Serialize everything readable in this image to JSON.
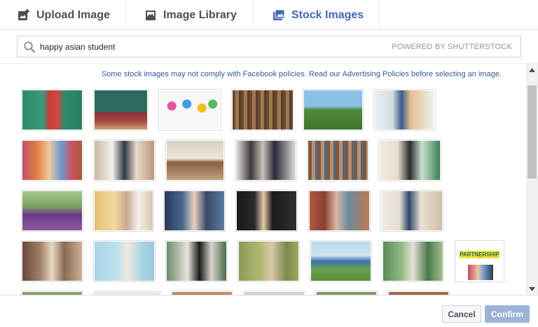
{
  "tabs": [
    {
      "label": "Upload Image",
      "icon": "upload-image-icon",
      "active": false
    },
    {
      "label": "Image Library",
      "icon": "image-library-icon",
      "active": false
    },
    {
      "label": "Stock Images",
      "icon": "stock-images-icon",
      "active": true
    }
  ],
  "search": {
    "value": "happy asian student",
    "placeholder": "",
    "powered_by": "POWERED BY SHUTTERSTOCK"
  },
  "notice": "Some stock images may not comply with Facebook policies. Read our Advertising Policies before selecting an image.",
  "footer": {
    "cancel_label": "Cancel",
    "confirm_label": "Confirm"
  },
  "results_banner_text": "PARTNERSHIP",
  "colors": {
    "accent": "#4267b2",
    "link": "#365899",
    "confirm_disabled": "#9cb4d8"
  }
}
